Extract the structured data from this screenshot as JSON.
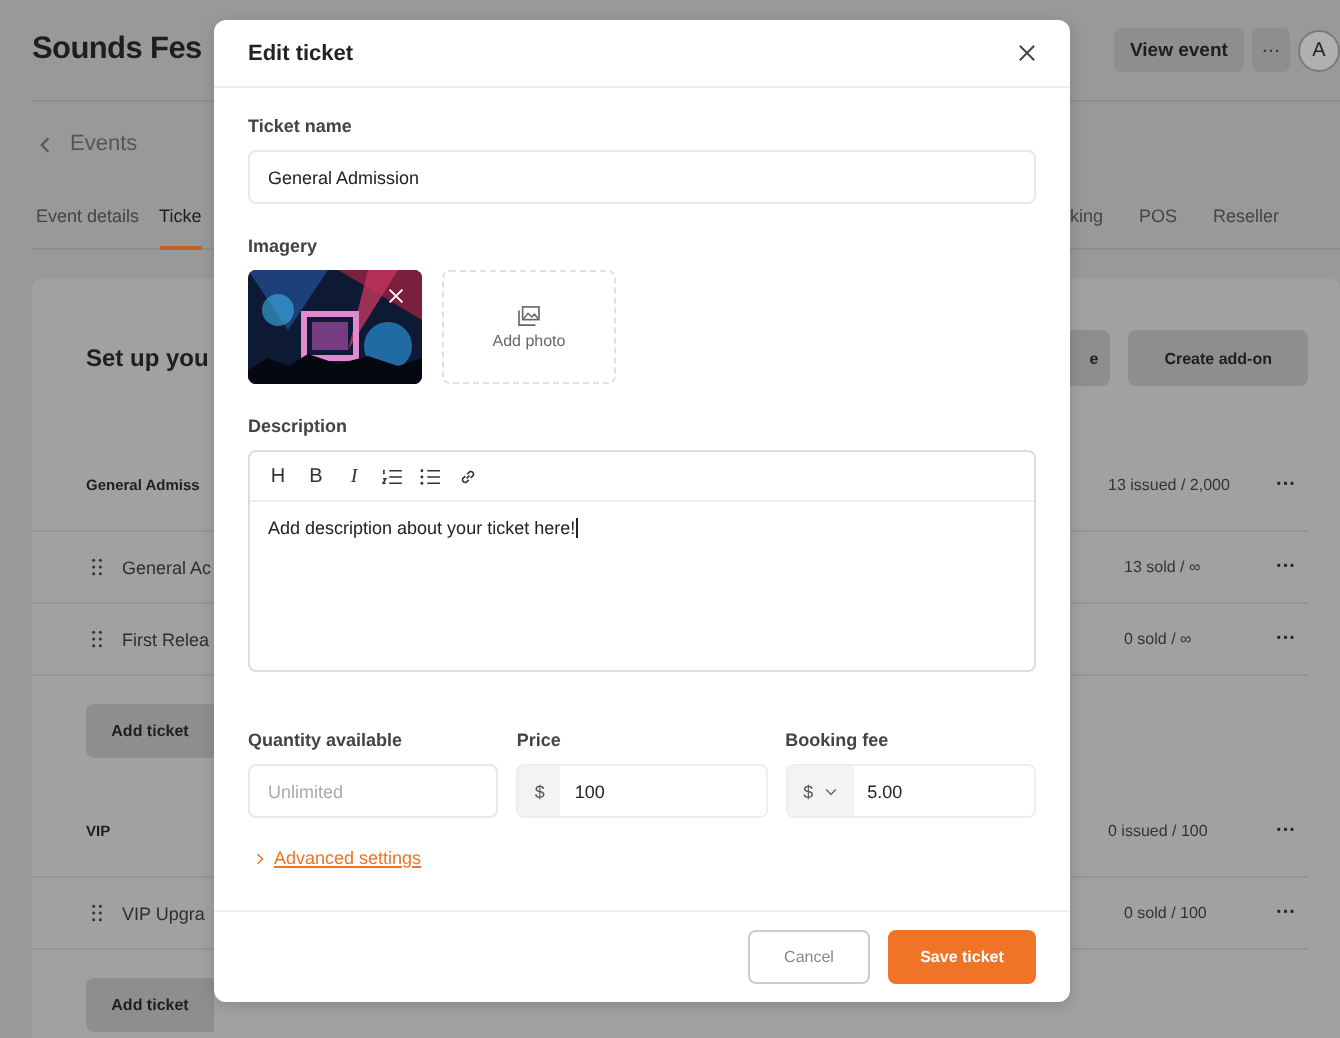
{
  "page": {
    "title": "Sounds Fes",
    "view_button": "View event",
    "more_button": "···",
    "avatar": "A",
    "breadcrumb": "Events"
  },
  "tabs": [
    {
      "label": "Event details",
      "selected": false
    },
    {
      "label": "Ticke",
      "selected": true
    },
    {
      "label": "king",
      "selected": false
    },
    {
      "label": "POS",
      "selected": false
    },
    {
      "label": "Reseller",
      "selected": false
    }
  ],
  "setup": {
    "heading": "Set up you",
    "buttons": [
      "e",
      "Create add-on"
    ]
  },
  "ticket_groups": [
    {
      "name": "General Admiss",
      "count": "13 issued / 2,000",
      "menu": "···",
      "tickets": [
        {
          "name": "General Ac",
          "count": "13 sold / ∞",
          "menu": "···"
        },
        {
          "name": "First Relea",
          "count": "0 sold / ∞",
          "menu": "···"
        }
      ],
      "add_button": "Add ticket"
    },
    {
      "name": "VIP",
      "count": "0 issued / 100",
      "menu": "···",
      "tickets": [
        {
          "name": "VIP Upgra",
          "count": "0 sold / 100",
          "menu": "···"
        }
      ],
      "add_button": "Add ticket"
    }
  ],
  "dialog": {
    "title": "Edit ticket",
    "ticket_name": {
      "label": "Ticket name",
      "value": "General Admission"
    },
    "imagery": {
      "label": "Imagery",
      "add_label": "Add photo"
    },
    "description": {
      "label": "Description",
      "toolbar": [
        {
          "kind": "heading",
          "glyph": "H"
        },
        {
          "kind": "bold",
          "glyph": "B"
        },
        {
          "kind": "italic",
          "glyph": "I"
        },
        {
          "kind": "ordered-list"
        },
        {
          "kind": "bullet-list"
        },
        {
          "kind": "link"
        }
      ],
      "value": "Add description about your ticket here!"
    },
    "fields": [
      {
        "label": "Quantity available",
        "placeholder": "Unlimited"
      },
      {
        "label": "Price",
        "prefix": "$",
        "value": "100"
      },
      {
        "label": "Booking fee",
        "prefix": "$",
        "dropdown": true,
        "value": "5.00"
      }
    ],
    "advanced_link": "Advanced settings",
    "buttons": [
      {
        "kind": "secondary",
        "label": "Cancel"
      },
      {
        "kind": "primary",
        "label": "Save ticket"
      }
    ]
  }
}
